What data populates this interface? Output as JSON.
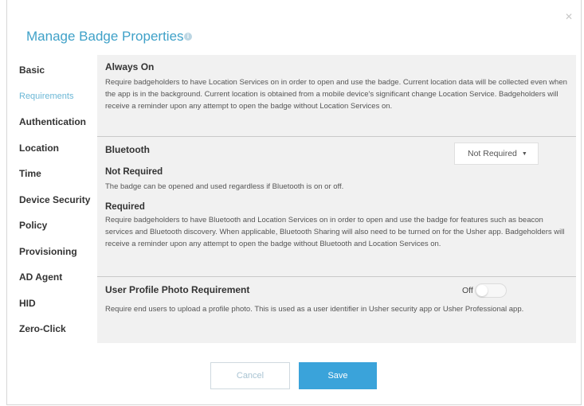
{
  "dialog": {
    "title": "Manage Badge Properties",
    "close_icon": "close-icon",
    "info_icon": "info-icon"
  },
  "sidebar": {
    "items": [
      {
        "label": "Basic"
      },
      {
        "label": "Requirements",
        "active": true
      },
      {
        "label": "Authentication"
      },
      {
        "label": "Location"
      },
      {
        "label": "Time"
      },
      {
        "label": "Device Security"
      },
      {
        "label": "Policy"
      },
      {
        "label": "Provisioning"
      },
      {
        "label": "AD Agent"
      },
      {
        "label": "HID"
      },
      {
        "label": "Zero-Click"
      }
    ]
  },
  "always_on": {
    "heading": "Always On",
    "description": "Require badgeholders to have Location Services on in order to open and use the badge. Current location data will be collected even when the app is in the background. Current location is obtained from a mobile device's significant change Location Service. Badgeholders will receive a reminder upon any attempt to open the badge without Location Services on."
  },
  "bluetooth": {
    "heading": "Bluetooth",
    "select_value": "Not Required",
    "not_required_heading": "Not Required",
    "not_required_text": "The badge can be opened and used regardless if Bluetooth is on or off.",
    "required_heading": "Required",
    "required_text": "Require badgeholders to have Bluetooth and Location Services on in order to open and use the badge for features such as beacon services and Bluetooth discovery. When applicable, Bluetooth Sharing will also need to be turned on for the Usher app. Badgeholders will receive a reminder upon any attempt to open the badge without Bluetooth and Location Services on."
  },
  "photo": {
    "heading": "User Profile Photo Requirement",
    "toggle_label": "Off",
    "toggle_on": false,
    "description": "Require end users to upload a profile photo. This is used as a user identifier in Usher security app or Usher Professional app."
  },
  "footer": {
    "cancel_label": "Cancel",
    "save_label": "Save"
  },
  "colors": {
    "accent": "#3fa1c8",
    "save_button": "#3aa3da",
    "panel_bg": "#f1f1f1"
  }
}
